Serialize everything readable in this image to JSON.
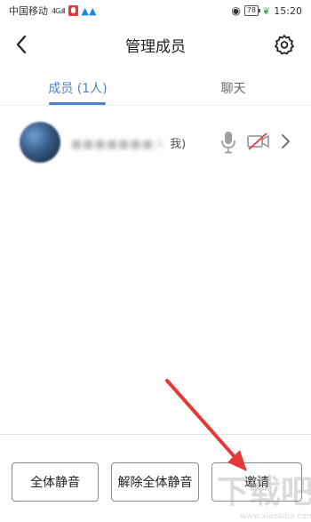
{
  "status_bar": {
    "carrier": "中国移动",
    "signal": "4G.ıll",
    "battery": "78",
    "time": "15:20",
    "icons": [
      "record-icon",
      "app-icon",
      "eye-icon",
      "battery-icon",
      "leaf-icon"
    ]
  },
  "header": {
    "title": "管理成员",
    "back_icon": "chevron-left-icon",
    "settings_icon": "gear-icon"
  },
  "tabs": [
    {
      "label": "成员 (1人)",
      "active": true
    },
    {
      "label": "聊天",
      "active": false
    }
  ],
  "members": [
    {
      "name_blurred": "■■■■■■■人",
      "name_suffix": "我)",
      "mic": "microphone-icon",
      "camera": "camera-off-icon",
      "detail": "chevron-right-icon"
    }
  ],
  "actions": {
    "mute_all": "全体静音",
    "unmute_all": "解除全体静音",
    "invite": "邀请"
  },
  "colors": {
    "accent": "#4a7fd4",
    "arrow": "#e53935"
  }
}
